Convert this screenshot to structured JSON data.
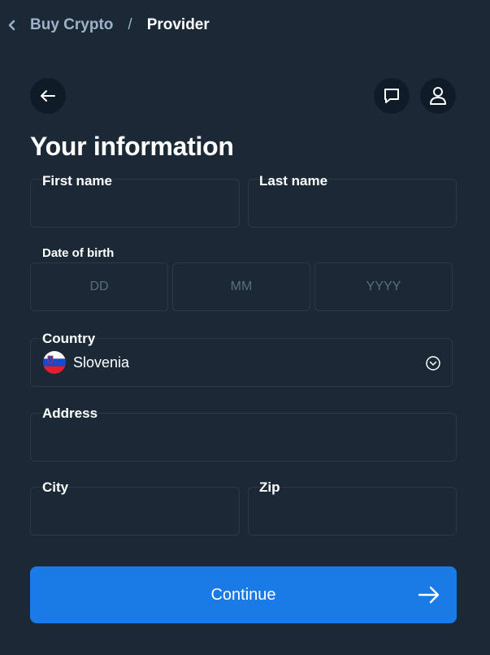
{
  "breadcrumb": {
    "parent": "Buy Crypto",
    "separator": "/",
    "current": "Provider"
  },
  "header": {
    "back_icon": "arrow-left-icon",
    "chat_icon": "chat-bubble-icon",
    "user_icon": "user-icon"
  },
  "title": "Your information",
  "form": {
    "first_name": {
      "label": "First name",
      "value": ""
    },
    "last_name": {
      "label": "Last name",
      "value": ""
    },
    "dob": {
      "label": "Date of birth",
      "day_placeholder": "DD",
      "month_placeholder": "MM",
      "year_placeholder": "YYYY"
    },
    "country": {
      "label": "Country",
      "value": "Slovenia",
      "flag_icon": "slovenia-flag-icon"
    },
    "address": {
      "label": "Address",
      "value": ""
    },
    "city": {
      "label": "City",
      "value": ""
    },
    "zip": {
      "label": "Zip",
      "value": ""
    }
  },
  "continue_button": {
    "label": "Continue",
    "color": "#1a7ae6"
  },
  "colors": {
    "background": "#1b2937",
    "circle_button": "#0f1b26",
    "field_border": "#2b3947",
    "muted_text": "#9fb1c7"
  }
}
